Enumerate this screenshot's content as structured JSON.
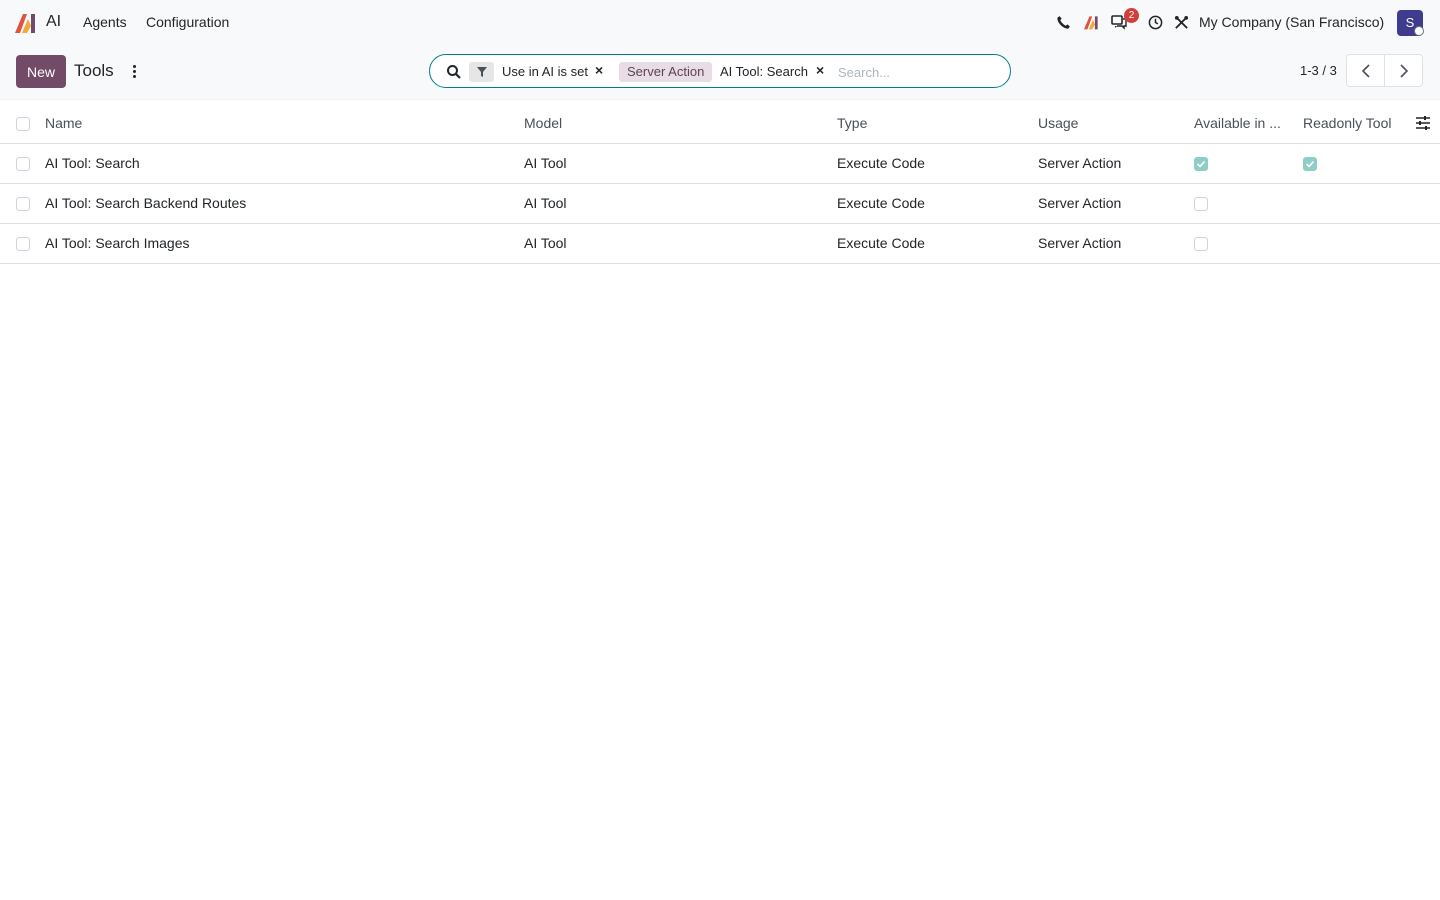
{
  "navbar": {
    "app_name": "AI",
    "menu": [
      {
        "label": "Agents"
      },
      {
        "label": "Configuration"
      }
    ],
    "chat_badge": "2",
    "company": "My Company (San Francisco)",
    "avatar_letter": "S",
    "icons": [
      "phone-icon",
      "ai-icon",
      "chat-icon",
      "clock-icon",
      "tools-icon"
    ]
  },
  "control": {
    "new_label": "New",
    "title": "Tools",
    "search": {
      "facets": [
        {
          "icon": "filter-icon",
          "label": "Use in AI is set"
        },
        {
          "tag": "Server Action",
          "label": "AI Tool: Search"
        }
      ],
      "placeholder": "Search..."
    },
    "pager": "1-3 / 3"
  },
  "table": {
    "columns": [
      "Name",
      "Model",
      "Type",
      "Usage",
      "Available in ...",
      "Readonly Tool"
    ],
    "rows": [
      {
        "name": "AI Tool: Search",
        "model": "AI Tool",
        "type": "Execute Code",
        "usage": "Server Action",
        "available": true,
        "readonly": true
      },
      {
        "name": "AI Tool: Search Backend Routes",
        "model": "AI Tool",
        "type": "Execute Code",
        "usage": "Server Action",
        "available": false,
        "readonly": null
      },
      {
        "name": "AI Tool: Search Images",
        "model": "AI Tool",
        "type": "Execute Code",
        "usage": "Server Action",
        "available": false,
        "readonly": null
      }
    ]
  },
  "colors": {
    "brand": "#714b67",
    "accent": "#017e84",
    "checked": "#8fcdc7",
    "badge": "#d23f3a"
  }
}
